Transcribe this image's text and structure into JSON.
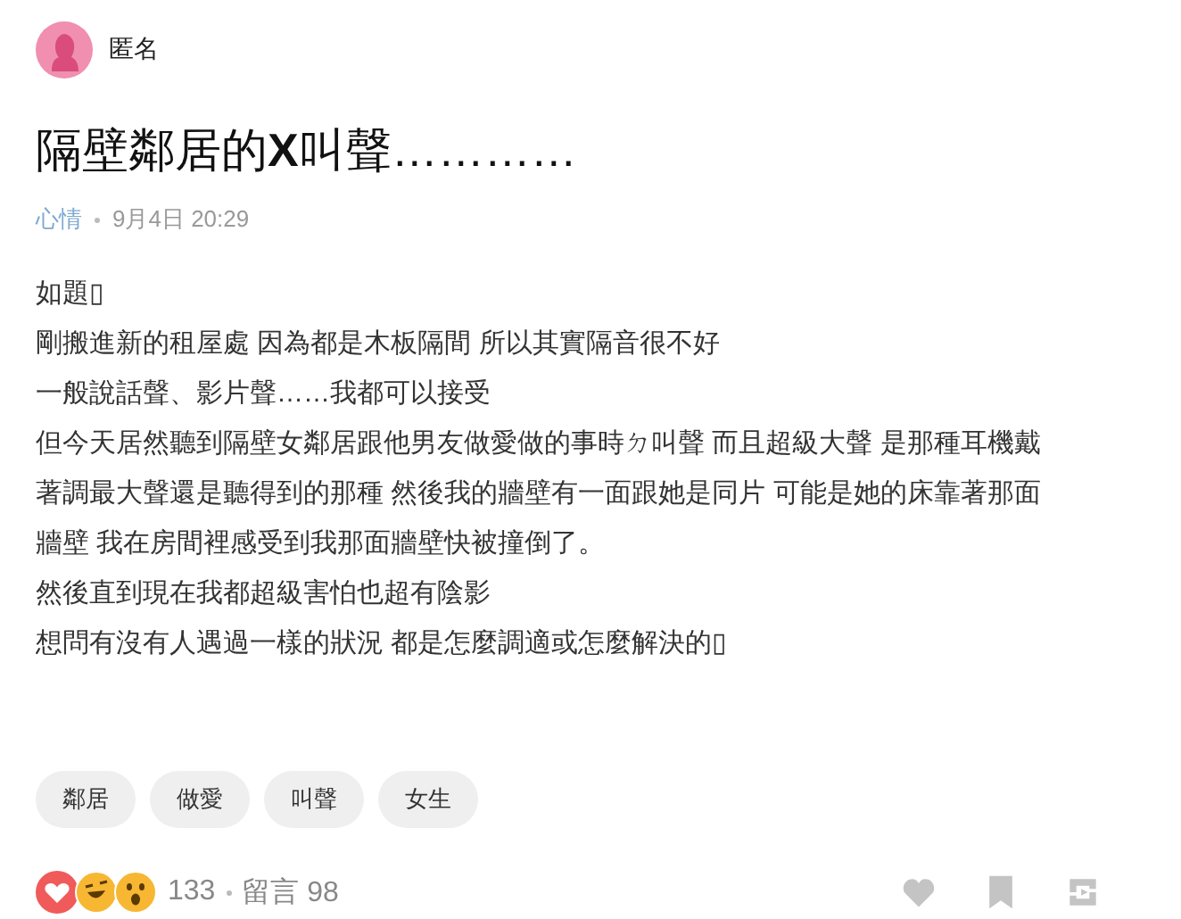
{
  "author": {
    "name": "匿名"
  },
  "post": {
    "title": "隔壁鄰居的**X**叫聲…………",
    "forum": "心情",
    "date": "9月4日 20:29",
    "paragraphs": [
      "如題▯",
      "剛搬進新的租屋處 因為都是木板隔間 所以其實隔音很不好",
      "一般說話聲、影片聲……我都可以接受",
      "但今天居然聽到隔壁女鄰居跟他男友做愛做的事時ㄉ叫聲 而且超級大聲 是那種耳機戴著調最大聲還是聽得到的那種 然後我的牆壁有一面跟她是同片 可能是她的床靠著那面牆壁 我在房間裡感受到我那面牆壁快被撞倒了。",
      "然後直到現在我都超級害怕也超有陰影",
      "想問有沒有人遇過一樣的狀況 都是怎麼調適或怎麼解決的▯"
    ]
  },
  "tags": [
    "鄰居",
    "做愛",
    "叫聲",
    "女生"
  ],
  "footer": {
    "reactions": [
      {
        "kind": "heart"
      },
      {
        "kind": "laugh"
      },
      {
        "kind": "wow"
      }
    ],
    "reaction_count": "133",
    "comments": "留言 98"
  }
}
